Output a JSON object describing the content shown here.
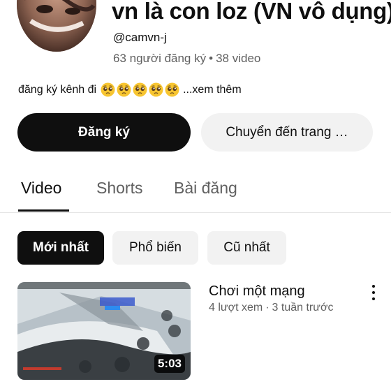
{
  "channel": {
    "name": "vn là con loz (VN vô dụng)",
    "handle": "@camvn-j",
    "subscribers": "63 người đăng ký",
    "video_count": "38 video",
    "separator": "•",
    "description": "đăng ký kênh đi",
    "description_emojis": [
      "pleading-face",
      "pleading-face",
      "pleading-face",
      "pleading-face",
      "pleading-face"
    ],
    "more_label": "...xem thêm"
  },
  "actions": {
    "subscribe_label": "Đăng ký",
    "goto_label": "Chuyển đến trang …"
  },
  "tabs": [
    {
      "label": "Video",
      "active": true
    },
    {
      "label": "Shorts",
      "active": false
    },
    {
      "label": "Bài đăng",
      "active": false
    }
  ],
  "sort_chips": [
    {
      "label": "Mới nhất",
      "selected": true
    },
    {
      "label": "Phổ biến",
      "selected": false
    },
    {
      "label": "Cũ nhất",
      "selected": false
    }
  ],
  "videos": [
    {
      "title": "Chơi một mạng",
      "views": "4 lượt xem",
      "age": "3 tuần trước",
      "separator": "·",
      "duration": "5:03"
    }
  ],
  "colors": {
    "primary_text": "#0f0f0f",
    "secondary_text": "#606060",
    "chip_bg": "#f2f2f2",
    "emoji": "#f7c531"
  }
}
